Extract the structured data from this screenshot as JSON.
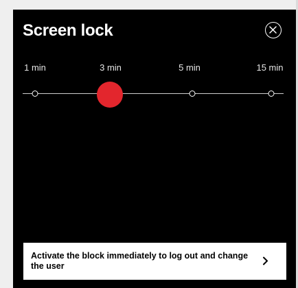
{
  "panel": {
    "title": "Screen lock"
  },
  "icons": {
    "close": "close-icon",
    "chevron": "chevron-right-icon"
  },
  "timeout_slider": {
    "options": [
      "1 min",
      "3 min",
      "5 min",
      "15 min"
    ],
    "selected_index": 1,
    "selected_value": "3 min"
  },
  "lock_button": {
    "label": "Activate the block immediately to log out and change the user"
  },
  "colors": {
    "background": "#000000",
    "accent": "#e3262d",
    "text": "#ffffff",
    "button_background": "#ffffff"
  }
}
